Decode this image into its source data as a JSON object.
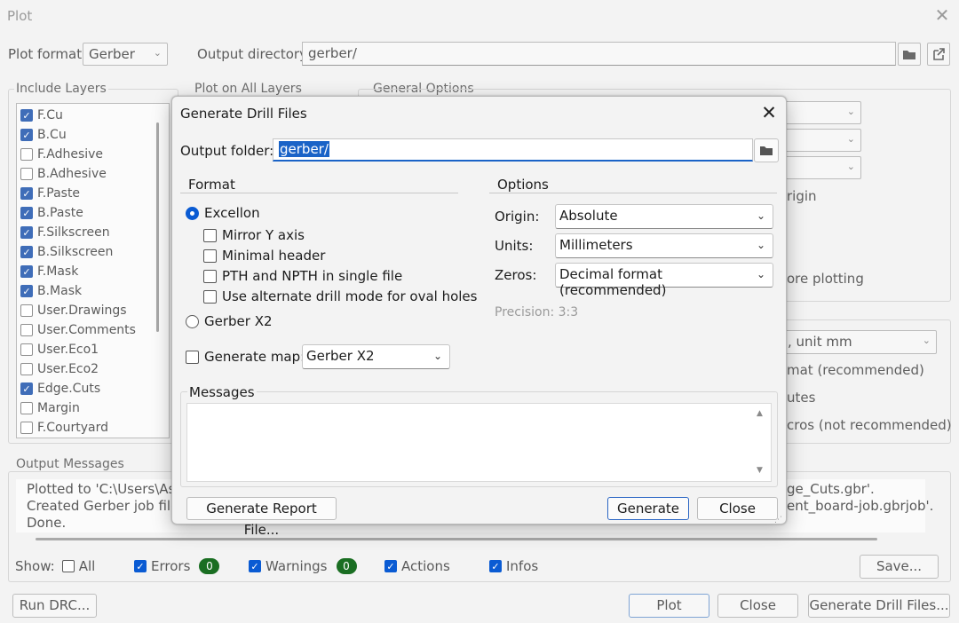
{
  "plot": {
    "title": "Plot",
    "plot_format_label": "Plot format:",
    "plot_format_value": "Gerber",
    "output_dir_label": "Output directory:",
    "output_dir_value": "gerber/",
    "include_layers_label": "Include Layers",
    "plot_all_layers_label": "Plot on All Layers",
    "general_options_label": "General Options",
    "layers": [
      {
        "name": "F.Cu",
        "checked": true
      },
      {
        "name": "B.Cu",
        "checked": true
      },
      {
        "name": "F.Adhesive",
        "checked": false
      },
      {
        "name": "B.Adhesive",
        "checked": false
      },
      {
        "name": "F.Paste",
        "checked": true
      },
      {
        "name": "B.Paste",
        "checked": true
      },
      {
        "name": "F.Silkscreen",
        "checked": true
      },
      {
        "name": "B.Silkscreen",
        "checked": true
      },
      {
        "name": "F.Mask",
        "checked": true
      },
      {
        "name": "B.Mask",
        "checked": true
      },
      {
        "name": "User.Drawings",
        "checked": false
      },
      {
        "name": "User.Comments",
        "checked": false
      },
      {
        "name": "User.Eco1",
        "checked": false
      },
      {
        "name": "User.Eco2",
        "checked": false
      },
      {
        "name": "Edge.Cuts",
        "checked": true
      },
      {
        "name": "Margin",
        "checked": false
      },
      {
        "name": "F.Courtyard",
        "checked": false
      }
    ],
    "right_partial": {
      "origin_suffix": "rigin",
      "plotting_suffix": "ore plotting",
      "unit_combo": ", unit mm",
      "format_suffix": "mat (recommended)",
      "utes_suffix": "utes",
      "macros_suffix": "cros (not recommended)"
    },
    "output_messages_label": "Output Messages",
    "messages": [
      {
        "left": "Plotted to 'C:\\Users\\As",
        "right": "ge_Cuts.gbr'."
      },
      {
        "left": "Created Gerber job file",
        "right": "ent_board-job.gbrjob'."
      },
      {
        "left": "Done.",
        "right": ""
      }
    ],
    "show_label": "Show:",
    "filters": {
      "all": "All",
      "errors": "Errors",
      "errors_count": "0",
      "warnings": "Warnings",
      "warnings_count": "0",
      "actions": "Actions",
      "infos": "Infos"
    },
    "save_button": "Save...",
    "run_drc_button": "Run DRC...",
    "plot_button": "Plot",
    "close_button": "Close",
    "generate_drill_button": "Generate Drill Files..."
  },
  "drill_dialog": {
    "title": "Generate Drill Files",
    "output_folder_label": "Output folder:",
    "output_folder_value": "gerber/",
    "format_label": "Format",
    "excellon_label": "Excellon",
    "excellon_options": [
      {
        "label": "Mirror Y axis",
        "checked": false
      },
      {
        "label": "Minimal header",
        "checked": false
      },
      {
        "label": "PTH and NPTH in single file",
        "checked": false
      },
      {
        "label": "Use alternate drill mode for oval holes",
        "checked": false
      }
    ],
    "gerber_x2_label": "Gerber X2",
    "generate_map_label": "Generate map:",
    "generate_map_value": "Gerber X2",
    "options_label": "Options",
    "origin_label": "Origin:",
    "origin_value": "Absolute",
    "units_label": "Units:",
    "units_value": "Millimeters",
    "zeros_label": "Zeros:",
    "zeros_value": "Decimal format (recommended)",
    "precision_text": "Precision:  3:3",
    "messages_label": "Messages",
    "generate_report_button": "Generate Report File...",
    "generate_button": "Generate",
    "close_button": "Close"
  }
}
